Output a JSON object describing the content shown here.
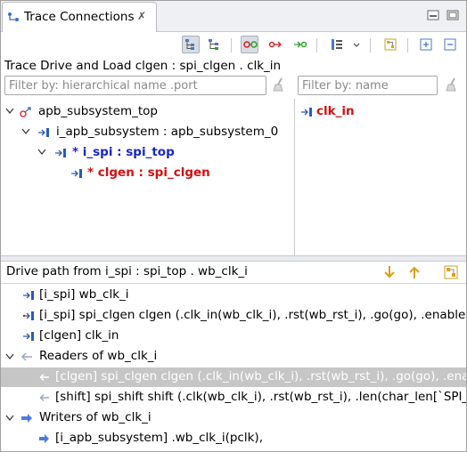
{
  "view_tab": {
    "title": "Trace Connections",
    "close_glyph": "✗"
  },
  "trace_title": "Trace Drive and Load clgen : spi_clgen . clk_in",
  "filters": {
    "hier_placeholder": "Filter by: hierarchical name .port",
    "name_placeholder": "Filter by: name"
  },
  "tree": {
    "items": [
      {
        "label": "apb_subsystem_top",
        "style": "normal"
      },
      {
        "label": "i_apb_subsystem : apb_subsystem_0",
        "style": "normal"
      },
      {
        "label": "* i_spi : spi_top",
        "style": "blue-bold"
      },
      {
        "label": "* clgen : spi_clgen",
        "style": "red-bold"
      }
    ]
  },
  "port_list": {
    "items": [
      {
        "label": "clk_in"
      }
    ]
  },
  "drive_path": {
    "title": "Drive path from i_spi : spi_top . wb_clk_i",
    "rows": [
      {
        "label": "[i_spi] wb_clk_i",
        "kind": "port"
      },
      {
        "label": "[i_spi] spi_clgen clgen (.clk_in(wb_clk_i), .rst(wb_rst_i), .go(go), .enable(t",
        "kind": "port"
      },
      {
        "label": "[clgen] clk_in",
        "kind": "port"
      },
      {
        "label": "Readers of wb_clk_i",
        "kind": "readers-group"
      },
      {
        "label": "[clgen] spi_clgen clgen (.clk_in(wb_clk_i), .rst(wb_rst_i), .go(go), .enab",
        "kind": "reader",
        "selected": true
      },
      {
        "label": "[shift] spi_shift shift (.clk(wb_clk_i), .rst(wb_rst_i), .len(char_len[`SPI_",
        "kind": "reader"
      },
      {
        "label": "Writers of wb_clk_i",
        "kind": "writers-group"
      },
      {
        "label": "[i_apb_subsystem] .wb_clk_i(pclk),",
        "kind": "writer"
      }
    ]
  },
  "colors": {
    "accent_blue": "#1a25c8",
    "accent_red": "#d01010",
    "selection": "#c6c6c6",
    "port_icon": "#2a5ab8",
    "reader_arrow": "#9aa7c7",
    "writer_arrow": "#4a7de0"
  },
  "icons": {
    "tab": "trace-connections-icon",
    "toolbar": [
      "hierarchy-view-icon",
      "flat-view-icon",
      "trace-both-icon",
      "trace-drivers-icon",
      "trace-loads-icon",
      "layout-menu-icon",
      "dropdown-icon",
      "show-port-icon",
      "expand-all-icon",
      "collapse-all-icon"
    ],
    "header": [
      "move-down-icon",
      "move-up-icon",
      "show-port-icon"
    ]
  }
}
